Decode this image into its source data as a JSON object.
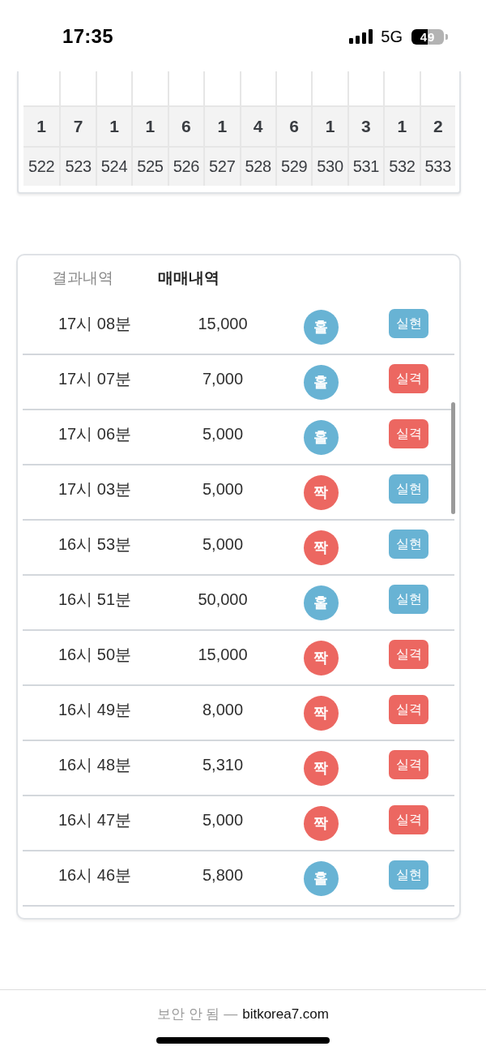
{
  "status_bar": {
    "time": "17:35",
    "network": "5G",
    "battery": "49"
  },
  "result_grid": {
    "columns": [
      {
        "result": "1",
        "round": "522"
      },
      {
        "result": "7",
        "round": "523"
      },
      {
        "result": "1",
        "round": "524"
      },
      {
        "result": "1",
        "round": "525"
      },
      {
        "result": "6",
        "round": "526"
      },
      {
        "result": "1",
        "round": "527"
      },
      {
        "result": "4",
        "round": "528"
      },
      {
        "result": "6",
        "round": "529"
      },
      {
        "result": "1",
        "round": "530"
      },
      {
        "result": "3",
        "round": "531"
      },
      {
        "result": "1",
        "round": "532"
      },
      {
        "result": "2",
        "round": "533"
      }
    ]
  },
  "tabs": [
    {
      "label": "결과내역",
      "selected": false
    },
    {
      "label": "매매내역",
      "selected": true
    }
  ],
  "trades": [
    {
      "time": "17시 08분",
      "amount": "15,000",
      "pick": {
        "label": "홀",
        "kind": "odd"
      },
      "result": {
        "label": "실현",
        "kind": "win"
      }
    },
    {
      "time": "17시 07분",
      "amount": "7,000",
      "pick": {
        "label": "홀",
        "kind": "odd"
      },
      "result": {
        "label": "실격",
        "kind": "loss"
      }
    },
    {
      "time": "17시 06분",
      "amount": "5,000",
      "pick": {
        "label": "홀",
        "kind": "odd"
      },
      "result": {
        "label": "실격",
        "kind": "loss"
      }
    },
    {
      "time": "17시 03분",
      "amount": "5,000",
      "pick": {
        "label": "짝",
        "kind": "even"
      },
      "result": {
        "label": "실현",
        "kind": "win"
      }
    },
    {
      "time": "16시 53분",
      "amount": "5,000",
      "pick": {
        "label": "짝",
        "kind": "even"
      },
      "result": {
        "label": "실현",
        "kind": "win"
      }
    },
    {
      "time": "16시 51분",
      "amount": "50,000",
      "pick": {
        "label": "홀",
        "kind": "odd"
      },
      "result": {
        "label": "실현",
        "kind": "win"
      }
    },
    {
      "time": "16시 50분",
      "amount": "15,000",
      "pick": {
        "label": "짝",
        "kind": "even"
      },
      "result": {
        "label": "실격",
        "kind": "loss"
      }
    },
    {
      "time": "16시 49분",
      "amount": "8,000",
      "pick": {
        "label": "짝",
        "kind": "even"
      },
      "result": {
        "label": "실격",
        "kind": "loss"
      }
    },
    {
      "time": "16시 48분",
      "amount": "5,310",
      "pick": {
        "label": "짝",
        "kind": "even"
      },
      "result": {
        "label": "실격",
        "kind": "loss"
      }
    },
    {
      "time": "16시 47분",
      "amount": "5,000",
      "pick": {
        "label": "짝",
        "kind": "even"
      },
      "result": {
        "label": "실격",
        "kind": "loss"
      }
    },
    {
      "time": "16시 46분",
      "amount": "5,800",
      "pick": {
        "label": "홀",
        "kind": "odd"
      },
      "result": {
        "label": "실현",
        "kind": "win"
      }
    }
  ],
  "footer": {
    "security_note": "보안 안 됨 —",
    "url": "bitkorea7.com"
  }
}
